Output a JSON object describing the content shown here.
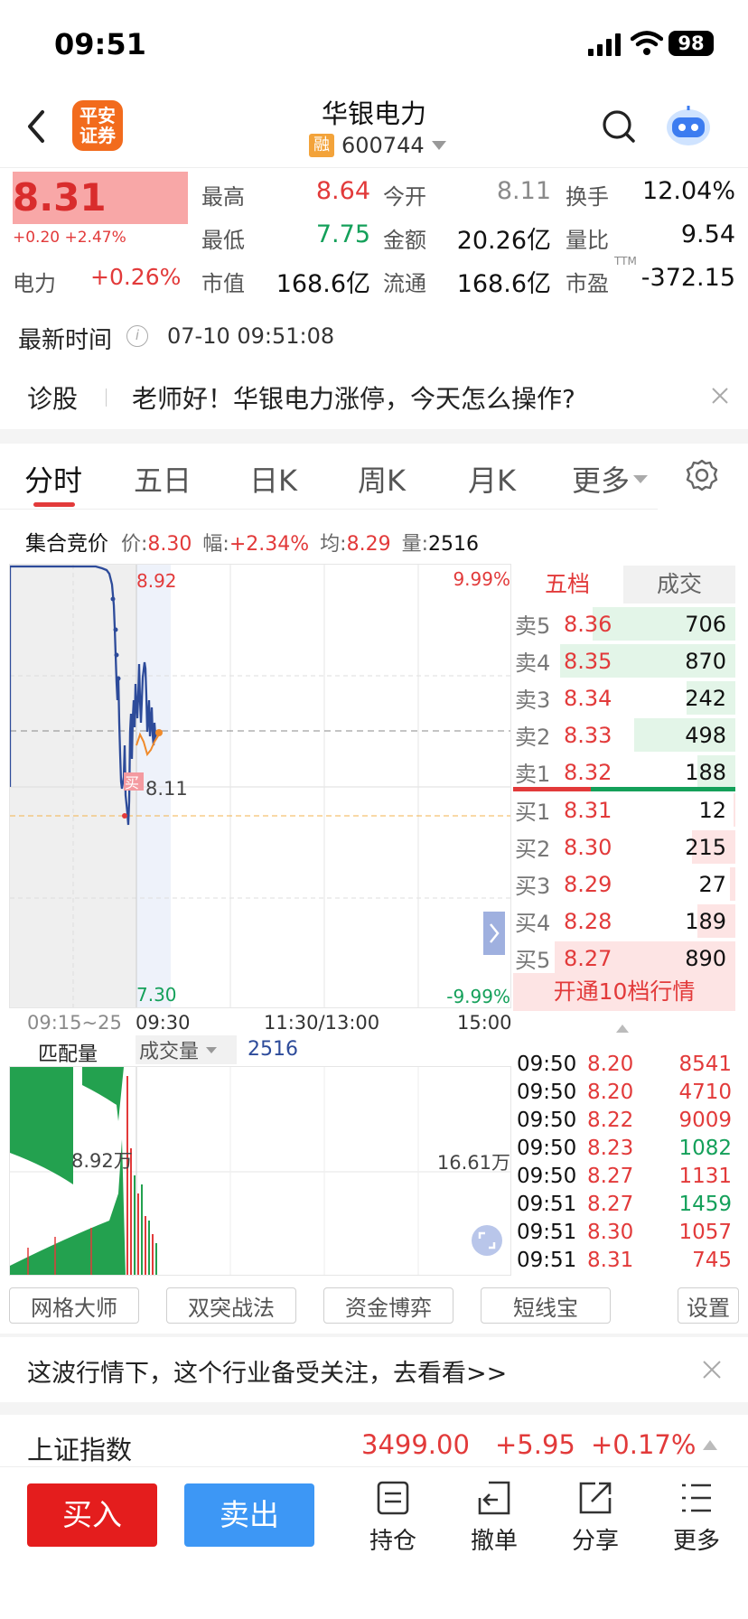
{
  "status": {
    "time": "09:51",
    "battery": "98"
  },
  "header": {
    "title": "华银电力",
    "rong": "融",
    "code": "600744",
    "logo_line1": "平安",
    "logo_line2": "证券"
  },
  "quote": {
    "price": "8.31",
    "change": "+0.20 +2.47%",
    "stats": [
      {
        "label": "最高",
        "value": "8.64"
      },
      {
        "label": "今开",
        "value": "8.11"
      },
      {
        "label": "换手",
        "value": "12.04%"
      },
      {
        "label": "最低",
        "value": "7.75"
      },
      {
        "label": "金额",
        "value": "20.26亿"
      },
      {
        "label": "量比",
        "value": "9.54"
      },
      {
        "label": "市值",
        "value": "168.6亿"
      },
      {
        "label": "流通",
        "value": "168.6亿"
      },
      {
        "label": "市盈",
        "value": "-372.15"
      }
    ],
    "sector_label": "电力",
    "sector_change": "+0.26%",
    "ttm": "TTM",
    "time_label": "最新时间",
    "time_value": "07-10 09:51:08"
  },
  "diagnose": {
    "label": "诊股",
    "text": "老师好！华银电力涨停，今天怎么操作?"
  },
  "tabs": [
    "分时",
    "五日",
    "日K",
    "周K",
    "月K",
    "更多"
  ],
  "auction": {
    "title": "集合竞价",
    "price_label": "价:",
    "price": "8.30",
    "amp_label": "幅:",
    "amp": "+2.34%",
    "avg_label": "均:",
    "avg": "8.29",
    "vol_label": "量:",
    "vol": "2516"
  },
  "chart": {
    "top_price": "8.92",
    "top_pct": "9.99%",
    "bottom_price": "7.30",
    "bottom_pct": "-9.99%",
    "marker_price": "8.11",
    "marker_tag": "买",
    "x_labels": [
      "09:15~25",
      "09:30",
      "11:30/13:00",
      "15:00"
    ],
    "vol_tab1": "匹配量",
    "vol_tab2": "成交量",
    "vol_value": "2516",
    "vol_left": "8.92万",
    "vol_right": "16.61万"
  },
  "orderbook": {
    "tabs": [
      "五档",
      "成交"
    ],
    "asks": [
      {
        "label": "卖5",
        "price": "8.36",
        "vol": "706",
        "fill": 0.79
      },
      {
        "label": "卖4",
        "price": "8.35",
        "vol": "870",
        "fill": 0.97
      },
      {
        "label": "卖3",
        "price": "8.34",
        "vol": "242",
        "fill": 0.27
      },
      {
        "label": "卖2",
        "price": "8.33",
        "vol": "498",
        "fill": 0.56
      },
      {
        "label": "卖1",
        "price": "8.32",
        "vol": "188",
        "fill": 0.21
      }
    ],
    "bids": [
      {
        "label": "买1",
        "price": "8.31",
        "vol": "12",
        "fill": 0.01
      },
      {
        "label": "买2",
        "price": "8.30",
        "vol": "215",
        "fill": 0.24
      },
      {
        "label": "买3",
        "price": "8.29",
        "vol": "27",
        "fill": 0.03
      },
      {
        "label": "买4",
        "price": "8.28",
        "vol": "189",
        "fill": 0.21
      },
      {
        "label": "买5",
        "price": "8.27",
        "vol": "890",
        "fill": 1.0
      }
    ],
    "upgrade": "开通10档行情",
    "ticks": [
      {
        "time": "09:50",
        "price": "8.20",
        "vol": "8541",
        "color": "#e23a3a"
      },
      {
        "time": "09:50",
        "price": "8.20",
        "vol": "4710",
        "color": "#e23a3a"
      },
      {
        "time": "09:50",
        "price": "8.22",
        "vol": "9009",
        "color": "#e23a3a"
      },
      {
        "time": "09:50",
        "price": "8.23",
        "vol": "1082",
        "color": "#14a05a"
      },
      {
        "time": "09:50",
        "price": "8.27",
        "vol": "1131",
        "color": "#e23a3a"
      },
      {
        "time": "09:51",
        "price": "8.27",
        "vol": "1459",
        "color": "#14a05a"
      },
      {
        "time": "09:51",
        "price": "8.30",
        "vol": "1057",
        "color": "#e23a3a"
      },
      {
        "time": "09:51",
        "price": "8.31",
        "vol": "745",
        "color": "#e23a3a"
      }
    ]
  },
  "tools": [
    "网格大师",
    "双突战法",
    "资金博弈",
    "短线宝",
    "设置"
  ],
  "banner": {
    "text": "这波行情下，这个行业备受关注，去看看>>"
  },
  "index": {
    "name": "上证指数",
    "value": "3499.00",
    "change": "+5.95",
    "pct": "+0.17%"
  },
  "toolbar": {
    "buy": "买入",
    "sell": "卖出",
    "hold": "持仓",
    "cancel": "撤单",
    "share": "分享",
    "more": "更多"
  }
}
